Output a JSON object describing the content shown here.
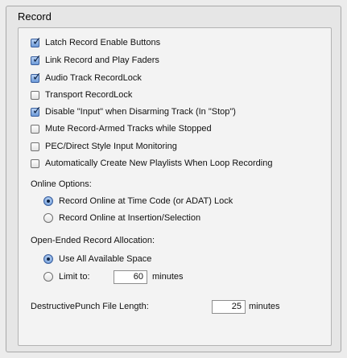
{
  "section": {
    "title": "Record"
  },
  "checkboxes": [
    {
      "label": "Latch Record Enable Buttons",
      "checked": true
    },
    {
      "label": "Link Record and Play Faders",
      "checked": true
    },
    {
      "label": "Audio Track RecordLock",
      "checked": true
    },
    {
      "label": "Transport RecordLock",
      "checked": false
    },
    {
      "label": "Disable \"Input\" when Disarming Track (In \"Stop\")",
      "checked": true
    },
    {
      "label": "Mute Record-Armed Tracks while Stopped",
      "checked": false
    },
    {
      "label": "PEC/Direct Style Input Monitoring",
      "checked": false
    },
    {
      "label": "Automatically Create New Playlists When Loop Recording",
      "checked": false
    }
  ],
  "online_options": {
    "label": "Online Options:",
    "options": [
      {
        "label": "Record Online at Time Code (or ADAT) Lock",
        "selected": true
      },
      {
        "label": "Record Online at Insertion/Selection",
        "selected": false
      }
    ]
  },
  "open_ended": {
    "label": "Open-Ended Record Allocation:",
    "use_all": {
      "label": "Use All Available Space",
      "selected": true
    },
    "limit": {
      "label": "Limit to:",
      "selected": false,
      "value": "60",
      "unit": "minutes"
    }
  },
  "destructive_punch": {
    "label": "DestructivePunch File Length:",
    "value": "25",
    "unit": "minutes"
  },
  "colors": {
    "accent": "#6d9ad8",
    "panel_bg": "#f3f3f3"
  },
  "icons": {
    "check": "checkmark-icon",
    "radio_dot": "radio-dot-icon"
  }
}
